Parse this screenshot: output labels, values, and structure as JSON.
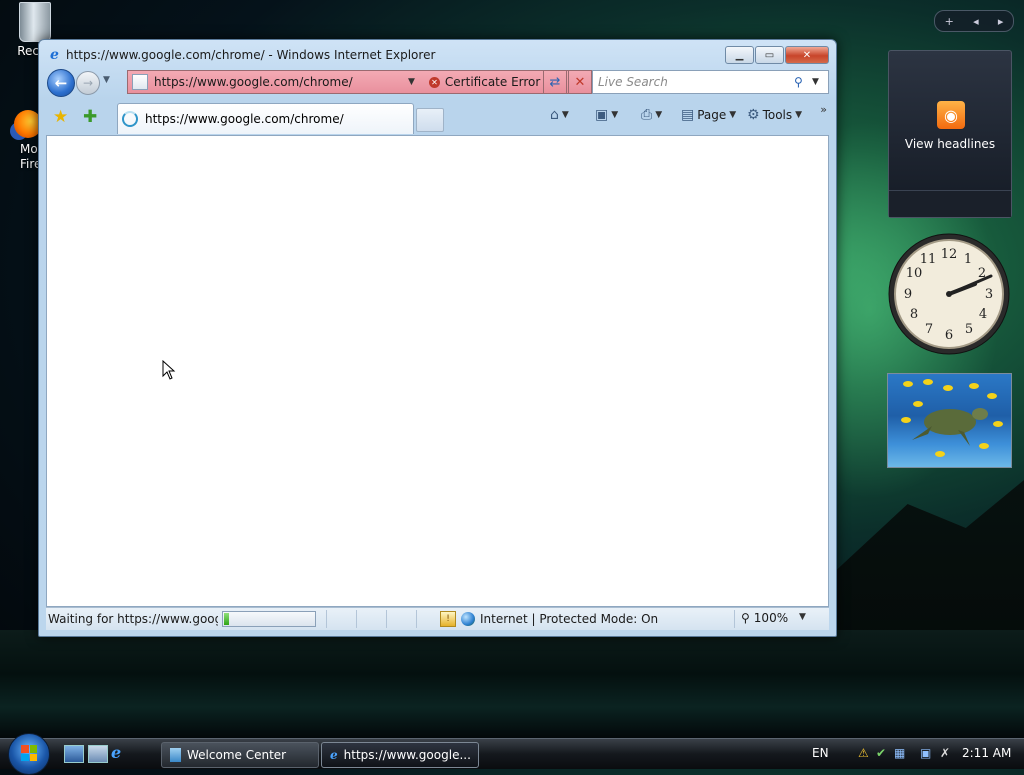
{
  "desktop": {
    "icons": [
      {
        "label": "Recyc"
      },
      {
        "label": "Mo\nFire"
      }
    ]
  },
  "window": {
    "title": "https://www.google.com/chrome/ - Windows Internet Explorer",
    "address": "https://www.google.com/chrome/",
    "certificate": "Certificate Error",
    "search_placeholder": "Live Search",
    "tab_title": "https://www.google.com/chrome/",
    "toolbar": {
      "page_label": "Page",
      "tools_label": "Tools"
    },
    "status_text": "Waiting for https://www.google",
    "progress_fraction": 0.05,
    "zone_text": "Internet | Protected Mode: On",
    "zoom": "100%"
  },
  "sidebar": {
    "feed_label": "View headlines",
    "clock_time": "2:11"
  },
  "taskbar": {
    "tasks": [
      "Welcome Center",
      "https://www.google..."
    ],
    "language": "EN",
    "time": "2:11 AM"
  },
  "colors": {
    "certificate_error_bg": "#e9909d",
    "progress_fill": "#2fa516"
  }
}
